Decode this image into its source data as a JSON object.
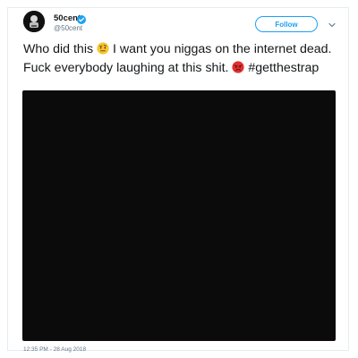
{
  "tweet": {
    "display_name": "50cent",
    "handle": "@50cent",
    "verified_icon": "verified-badge-icon",
    "follow_label": "Follow",
    "text_part1": "Who did this ",
    "text_part2": " I want you niggas on the internet dead. Fuck everybody laughing at this shit. ",
    "hashtag": "#getthestrap",
    "emoji_1": "face-with-raised-eyebrow-icon",
    "emoji_2": "angry-face-icon",
    "timestamp": "12:35 PM - 28 Aug 2018"
  },
  "colors": {
    "accent": "#1da1f2",
    "text": "#14171a",
    "muted": "#657786",
    "media_bg": "#0b0b0b"
  }
}
